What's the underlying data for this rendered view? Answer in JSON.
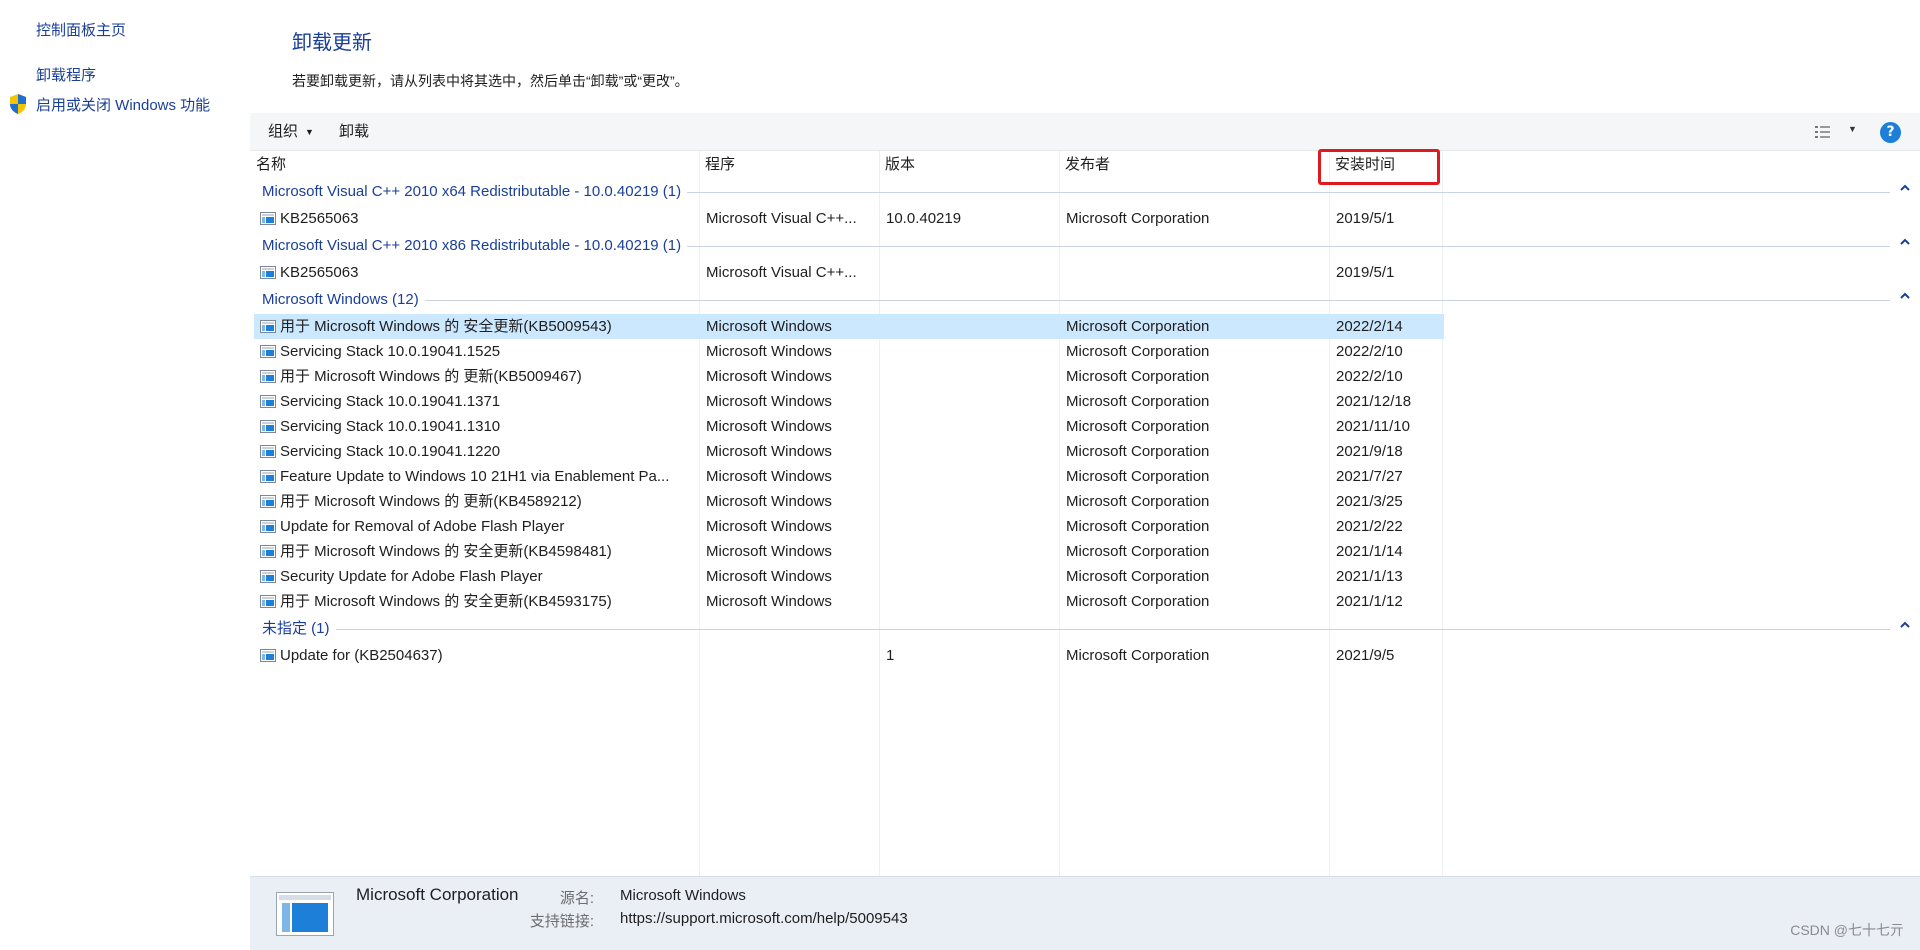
{
  "nav": {
    "home": "控制面板主页",
    "uninstall": "卸载程序",
    "features": "启用或关闭 Windows 功能"
  },
  "header": {
    "title": "卸载更新",
    "description": "若要卸载更新，请从列表中将其选中，然后单击“卸载”或“更改”。"
  },
  "toolbar": {
    "organize": "组织",
    "uninstall": "卸载",
    "help": "?"
  },
  "columns": {
    "name": "名称",
    "program": "程序",
    "version": "版本",
    "publisher": "发布者",
    "installed_on": "安装时间"
  },
  "groups": [
    {
      "label": "Microsoft Visual C++ 2010  x64 Redistributable - 10.0.40219 (1)",
      "rows": [
        {
          "name": "KB2565063",
          "program": "Microsoft Visual C++...",
          "version": "10.0.40219",
          "publisher": "Microsoft Corporation",
          "date": "2019/5/1"
        }
      ]
    },
    {
      "label": "Microsoft Visual C++ 2010  x86 Redistributable - 10.0.40219 (1)",
      "rows": [
        {
          "name": "KB2565063",
          "program": "Microsoft Visual C++...",
          "version": "",
          "publisher": "",
          "date": "2019/5/1"
        }
      ]
    },
    {
      "label": "Microsoft Windows (12)",
      "rows": [
        {
          "name": "用于 Microsoft Windows 的 安全更新(KB5009543)",
          "program": "Microsoft Windows",
          "version": "",
          "publisher": "Microsoft Corporation",
          "date": "2022/2/14",
          "selected": true
        },
        {
          "name": "Servicing Stack 10.0.19041.1525",
          "program": "Microsoft Windows",
          "version": "",
          "publisher": "Microsoft Corporation",
          "date": "2022/2/10"
        },
        {
          "name": "用于 Microsoft Windows 的 更新(KB5009467)",
          "program": "Microsoft Windows",
          "version": "",
          "publisher": "Microsoft Corporation",
          "date": "2022/2/10"
        },
        {
          "name": "Servicing Stack 10.0.19041.1371",
          "program": "Microsoft Windows",
          "version": "",
          "publisher": "Microsoft Corporation",
          "date": "2021/12/18"
        },
        {
          "name": "Servicing Stack 10.0.19041.1310",
          "program": "Microsoft Windows",
          "version": "",
          "publisher": "Microsoft Corporation",
          "date": "2021/11/10"
        },
        {
          "name": "Servicing Stack 10.0.19041.1220",
          "program": "Microsoft Windows",
          "version": "",
          "publisher": "Microsoft Corporation",
          "date": "2021/9/18"
        },
        {
          "name": "Feature Update to Windows 10 21H1 via Enablement Pa...",
          "program": "Microsoft Windows",
          "version": "",
          "publisher": "Microsoft Corporation",
          "date": "2021/7/27"
        },
        {
          "name": "用于 Microsoft Windows 的 更新(KB4589212)",
          "program": "Microsoft Windows",
          "version": "",
          "publisher": "Microsoft Corporation",
          "date": "2021/3/25"
        },
        {
          "name": "Update for Removal of Adobe Flash Player",
          "program": "Microsoft Windows",
          "version": "",
          "publisher": "Microsoft Corporation",
          "date": "2021/2/22"
        },
        {
          "name": "用于 Microsoft Windows 的 安全更新(KB4598481)",
          "program": "Microsoft Windows",
          "version": "",
          "publisher": "Microsoft Corporation",
          "date": "2021/1/14"
        },
        {
          "name": "Security Update for Adobe Flash Player",
          "program": "Microsoft Windows",
          "version": "",
          "publisher": "Microsoft Corporation",
          "date": "2021/1/13"
        },
        {
          "name": "用于 Microsoft Windows 的 安全更新(KB4593175)",
          "program": "Microsoft Windows",
          "version": "",
          "publisher": "Microsoft Corporation",
          "date": "2021/1/12"
        }
      ]
    },
    {
      "label": "未指定 (1)",
      "rows": [
        {
          "name": "Update for  (KB2504637)",
          "program": "",
          "version": "1",
          "publisher": "Microsoft Corporation",
          "date": "2021/9/5"
        }
      ]
    }
  ],
  "details": {
    "publisher": "Microsoft Corporation",
    "source_label": "源名:",
    "source_value": "Microsoft Windows",
    "link_label": "支持链接:",
    "link_value": "https://support.microsoft.com/help/5009543"
  },
  "watermark": "CSDN @七十七亓",
  "colors": {
    "link_blue": "#1a3f99",
    "selection": "#cce8ff",
    "highlight_box": "#e0191f",
    "details_bg": "#eaeff6"
  }
}
